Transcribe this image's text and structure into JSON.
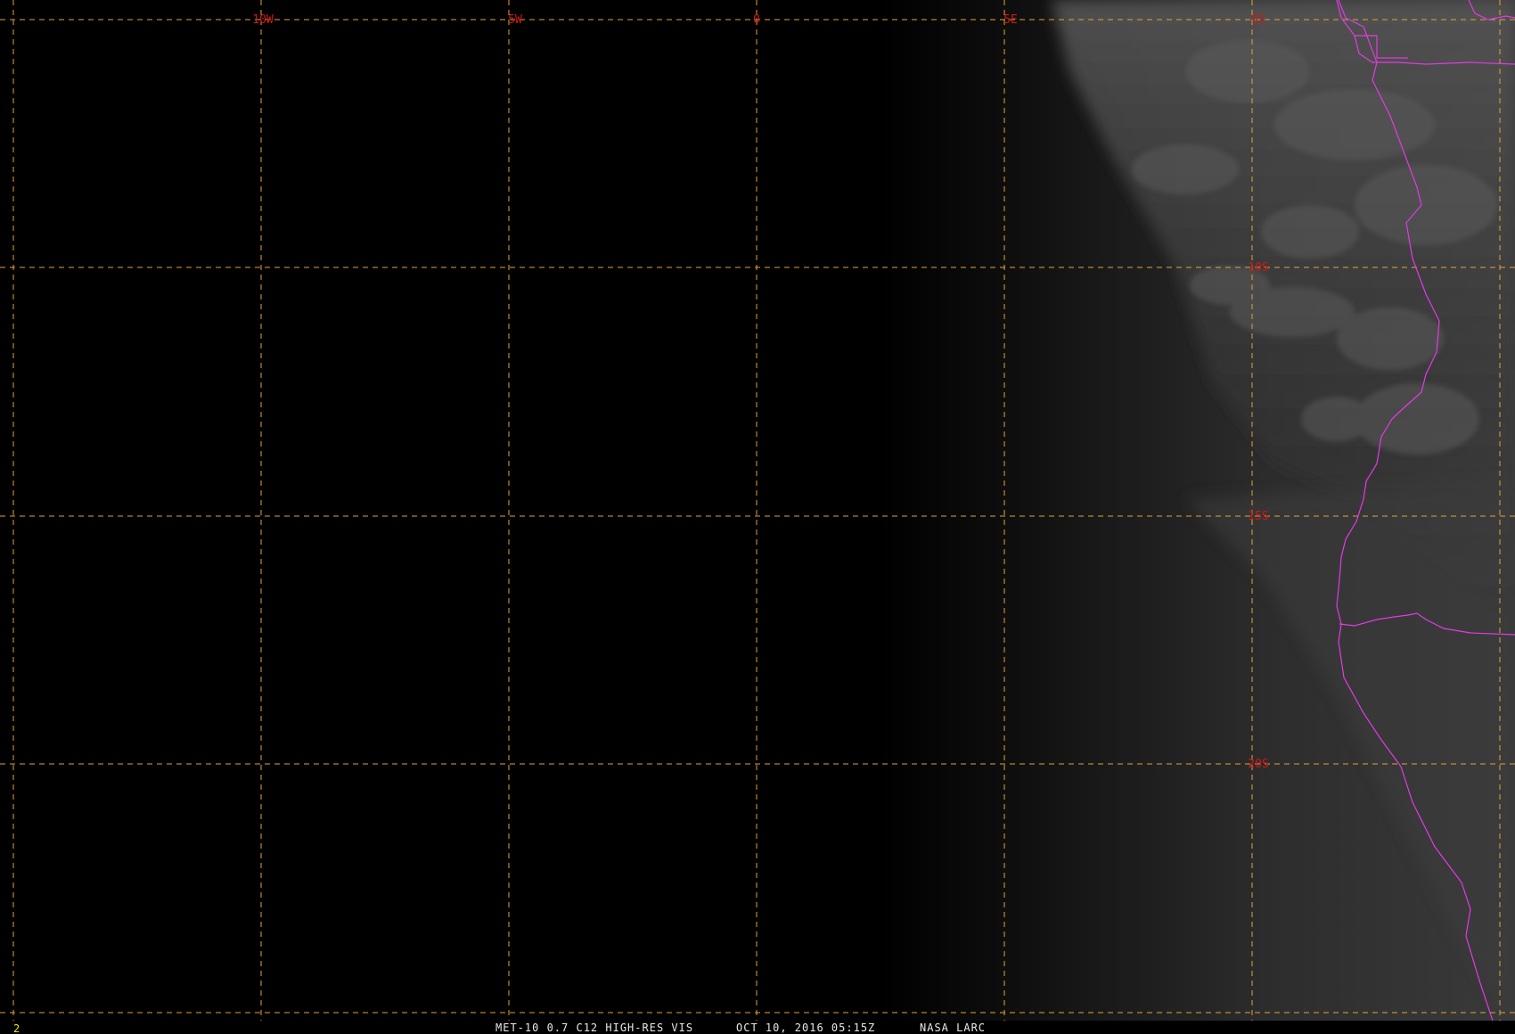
{
  "map": {
    "longitude_labels": [
      "10W",
      "5W",
      "0",
      "5E"
    ],
    "latitude_labels": [
      "5S",
      "10S",
      "15S",
      "20S"
    ],
    "colors": {
      "grid": "#e3a13b",
      "grid_label": "#d01818",
      "boundary": "#e23ae6",
      "footer_text": "#e8e8e8",
      "frame_number": "#e8e800"
    }
  },
  "footer": {
    "frame_number": "2",
    "product": "MET-10 0.7 C12 HIGH-RES VIS",
    "datetime": "OCT 10, 2016 05:15Z",
    "source": "NASA LARC"
  }
}
